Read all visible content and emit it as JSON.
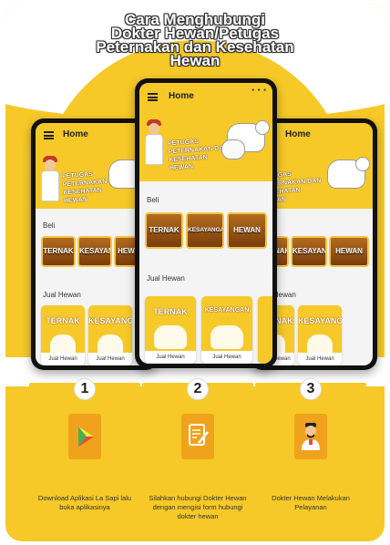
{
  "title": {
    "line1": "Cara Menghubungi",
    "line2": "Dokter Hewan/Petugas",
    "line3": "Peternakan dan Kesehatan",
    "line4": "Hewan"
  },
  "app": {
    "appbar_title": "Home",
    "banner_text_1": "PETUGAS PETERNAKAN",
    "banner_text_2": "DAN KESEHATAN HEWAN",
    "section_beli": "Beli",
    "section_jual": "Jual Hewan",
    "beli_tiles": [
      "TERNAK",
      "KESAYANGAN",
      "HEWAN"
    ],
    "jual_cards": [
      {
        "title": "TERNAK",
        "footer": "Jual Hewan"
      },
      {
        "title": "KESAYANGAN",
        "footer": "Jual Hewan"
      }
    ]
  },
  "steps": [
    {
      "number": "1",
      "icon": "play-store-icon",
      "text": "Download Aplikasi La Sapi lalu buka aplikasinya"
    },
    {
      "number": "2",
      "icon": "edit-form-icon",
      "text": "Silahkan hubungi Dokter Hewan dengan mengisi form hubungi dokter hewan"
    },
    {
      "number": "3",
      "icon": "doctor-icon",
      "text": "Dokter Hewan Melakukan Pelayanan"
    }
  ],
  "colors": {
    "accent": "#f6c928",
    "icon_bg": "#f1a21d",
    "tile_brown": "#8b4513"
  }
}
